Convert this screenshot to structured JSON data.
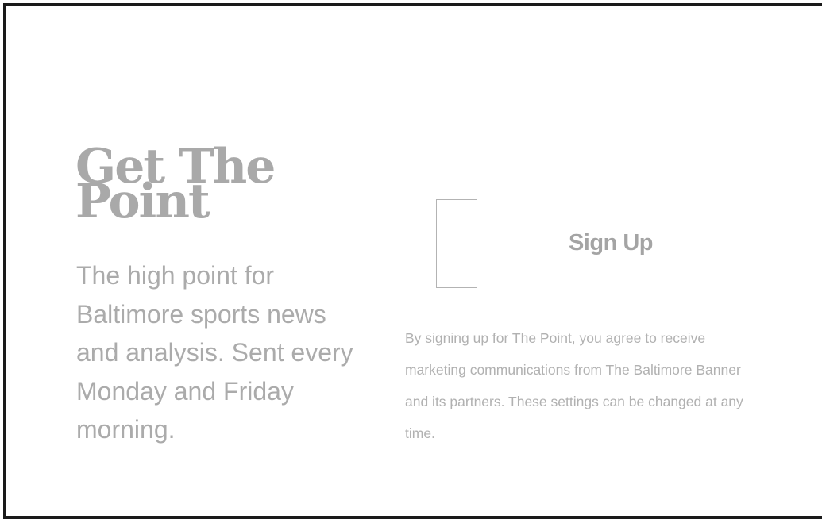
{
  "newsletter": {
    "title": "Get The Point",
    "description": "The high point for Baltimore sports news and analysis. Sent every Monday and Friday morning.",
    "email_placeholder": "",
    "signup_label": "Sign Up",
    "disclaimer": "By signing up for The Point, you agree to receive marketing communications from The Baltimore Banner and its partners. These settings can be changed at any time."
  },
  "colors": {
    "text_gray": "#a9a9a9",
    "border_dark": "#1a1a1a",
    "input_border": "#b3b3b3"
  }
}
